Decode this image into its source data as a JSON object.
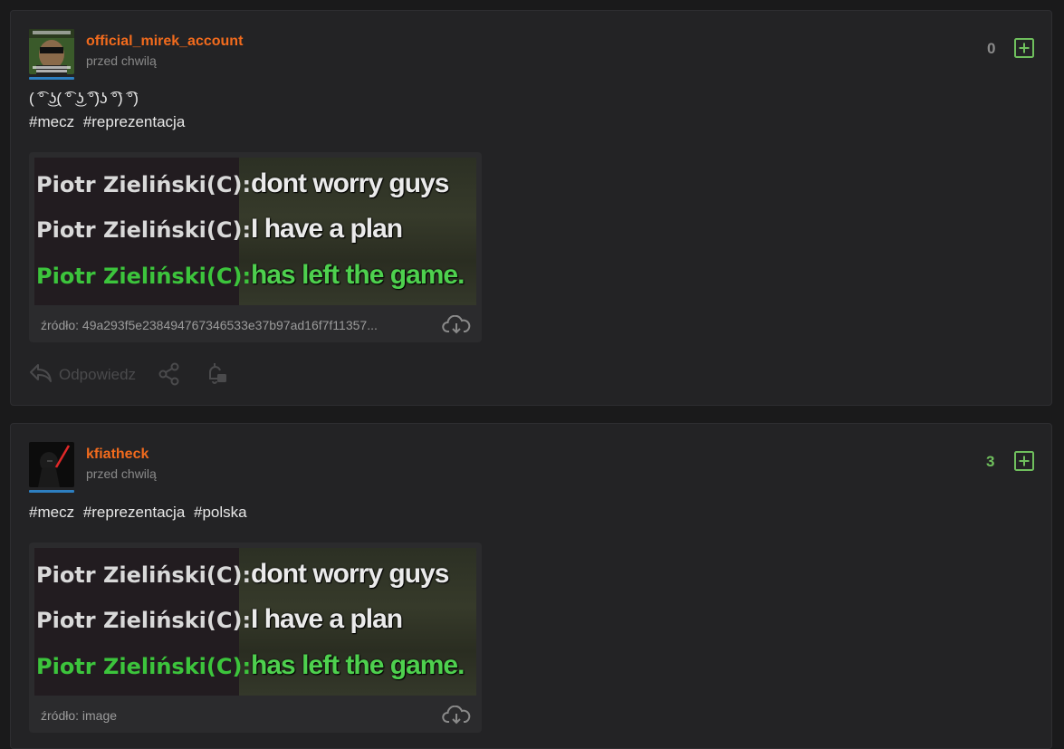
{
  "posts": [
    {
      "author": "official_mirek_account",
      "time": "przed chwilą",
      "score": "0",
      "text_line1": "( ͡° ͜ʖ( ͡° ͜ʖ ͡°)ʖ ͡°) ͡°)",
      "tags": [
        "#mecz",
        "#reprezentacja"
      ],
      "meme": {
        "lines": [
          {
            "who": "Piotr Zieliński(C):",
            "msg": "dont worry guys"
          },
          {
            "who": "Piotr Zieliński(C):",
            "msg": "I have a plan"
          },
          {
            "who": "Piotr Zieliński(C):",
            "msg": "has left the game."
          }
        ]
      },
      "source": "źródło: 49a293f5e238494767346533e37b97ad16f7f11357...",
      "actions": {
        "reply": "Odpowiedz"
      },
      "score_color": "#8a8a8a"
    },
    {
      "author": "kfiatheck",
      "time": "przed chwilą",
      "score": "3",
      "tags": [
        "#mecz",
        "#reprezentacja",
        "#polska"
      ],
      "meme": {
        "lines": [
          {
            "who": "Piotr Zieliński(C):",
            "msg": "dont worry guys"
          },
          {
            "who": "Piotr Zieliński(C):",
            "msg": "I have a plan"
          },
          {
            "who": "Piotr Zieliński(C):",
            "msg": "has left the game."
          }
        ]
      },
      "source": "źródło: image",
      "score_color": "#6fbf5d"
    }
  ],
  "colors": {
    "author": "#f26b1d",
    "plus": "#6fbf5d",
    "background": "#1a1a1b",
    "card": "#232325"
  },
  "icons": [
    "plus-icon",
    "cloud-download-icon",
    "reply-icon",
    "share-icon",
    "bell-icon"
  ]
}
